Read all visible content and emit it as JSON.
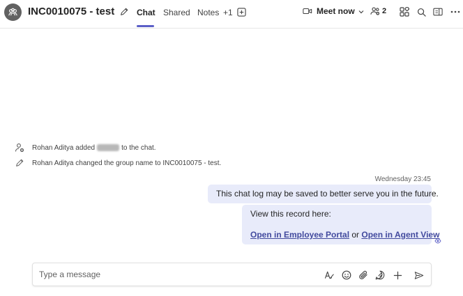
{
  "header": {
    "title": "INC0010075 - test",
    "tabs": [
      {
        "label": "Chat",
        "active": true
      },
      {
        "label": "Shared",
        "active": false
      },
      {
        "label": "Notes",
        "active": false
      },
      {
        "label": "+1",
        "active": false
      }
    ],
    "meet_now_label": "Meet now",
    "participants_count": "2",
    "accent_color": "#5b5fc7"
  },
  "system_messages": [
    {
      "icon": "person-add-icon",
      "before": "Rohan Aditya added",
      "after": "to the chat."
    },
    {
      "icon": "pencil-icon",
      "text": "Rohan Aditya changed the group name to INC0010075 - test."
    }
  ],
  "conversation": {
    "timestamp": "Wednesday 23:45",
    "message1": "This chat log may be saved to better serve you in the future.",
    "message2": {
      "line1": "View this record here:",
      "link1": "Open in Employee Portal",
      "connector": "or",
      "link2": "Open in Agent View"
    },
    "bubble_color": "#e8ebfa"
  },
  "composer": {
    "placeholder": "Type a message"
  }
}
